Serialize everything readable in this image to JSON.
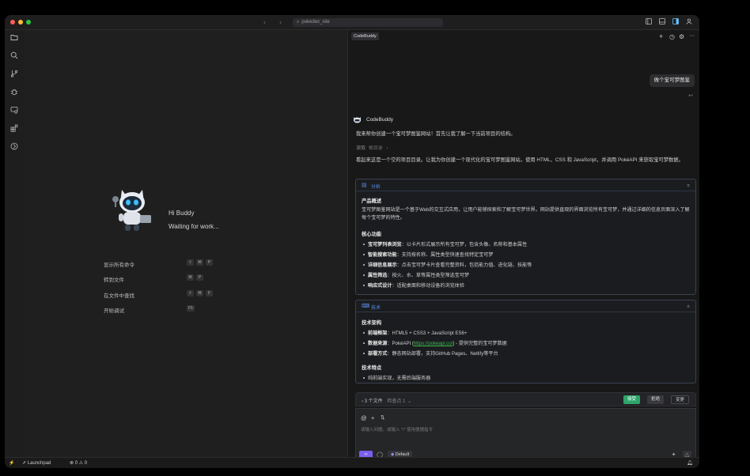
{
  "titlebar": {
    "back_icon": "‹",
    "forward_icon": "›",
    "search_text": "pokedex_site",
    "right_icons": [
      "sidebar-left-icon",
      "panel-bottom-icon",
      "sidebar-right-icon",
      "account-icon"
    ]
  },
  "activity_bar": [
    "explorer-icon",
    "search-icon",
    "source-control-icon",
    "debug-icon",
    "remote-icon",
    "extensions-icon",
    "codebuddy-icon"
  ],
  "welcome": {
    "greeting": "Hi Buddy",
    "status": "Waiting for work...",
    "shortcuts": [
      {
        "label": "显示所有命令",
        "keys": [
          "⇧",
          "⌘",
          "P"
        ]
      },
      {
        "label": "转到文件",
        "keys": [
          "⌘",
          "P"
        ]
      },
      {
        "label": "在文件中查找",
        "keys": [
          "⇧",
          "⌘",
          "F"
        ]
      },
      {
        "label": "开始调试",
        "keys": [
          "F5"
        ]
      }
    ]
  },
  "panel": {
    "tab": "CodeBuddy",
    "user_message": "做个宝可梦图鉴",
    "bot_name": "CodeBuddy",
    "intro": "我来帮你创建一个宝可梦图鉴网站！首先让我了解一下当前项目的结构。",
    "read_label": "读取",
    "read_target": "根目录",
    "analysis_text": "看起来这是一个空的项目目录。让我为你创建一个现代化的宝可梦图鉴网站，使用 HTML、CSS 和 JavaScript，并调用 PokéAPI 来获取宝可梦数据。",
    "card1": {
      "title": "分析",
      "overview_title": "产品概述",
      "overview": "宝可梦图鉴网站是一个基于Web的交互式应用，让用户能够探索和了解宝可梦世界。网站提供直观的界面浏览所有宝可梦，并通过详细的信息页面深入了解每个宝可梦的特性。",
      "features_title": "核心功能",
      "features": [
        {
          "name": "宝可梦列表浏览",
          "desc": "：以卡片形式展示所有宝可梦，包含头像、名称和基本属性"
        },
        {
          "name": "智能搜索功能",
          "desc": "：支持按名称、属性类型快速查找特定宝可梦"
        },
        {
          "name": "详细信息展示",
          "desc": "：点击宝可梦卡片查看完整资料，包括能力值、进化链、技能等"
        },
        {
          "name": "属性筛选",
          "desc": "：按火、水、草等属性类型筛选宝可梦"
        },
        {
          "name": "响应式设计",
          "desc": "：适配桌面和移动设备的浏览体验"
        }
      ]
    },
    "card2": {
      "title": "技术",
      "arch_title": "技术架构",
      "arch": [
        {
          "name": "前端框架",
          "desc": "：HTML5 + CSS3 + JavaScript ES6+"
        },
        {
          "name": "数据来源",
          "desc_pre": "：PokéAPI (",
          "link": "https://pokeapi.co/",
          "desc_post": ") - 提供完整的宝可梦数据"
        },
        {
          "name": "部署方式",
          "desc": "：静态网站部署，支持GitHub Pages、Netlify等平台"
        }
      ],
      "traits_title": "技术特点",
      "traits": [
        "纯前端实现，无需后端服务器"
      ]
    },
    "files": {
      "label": "3 个文件",
      "checkpoint": "检查点 1",
      "accept": "接受",
      "reject": "拒绝",
      "changes": "变更"
    },
    "input": {
      "placeholder": "请输入问题。或输入 \"/\" 使用便捷指令",
      "model": "Default"
    }
  },
  "statusbar": {
    "launchpad": "Launchpad",
    "errors": "0",
    "warnings": "0"
  },
  "colors": {
    "accent_blue": "#5a8ee8",
    "accent_purple": "#7b5ff0",
    "accept_green": "#2ea56a",
    "link_green": "#3fb950"
  }
}
